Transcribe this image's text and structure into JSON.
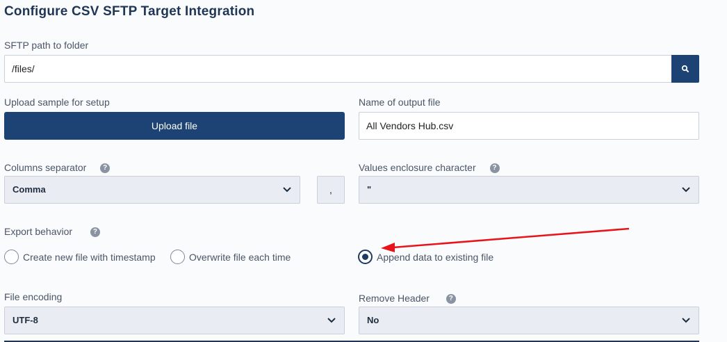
{
  "title": "Configure CSV SFTP Target Integration",
  "sftp": {
    "label": "SFTP path to folder",
    "value": "/files/",
    "search_icon": "search-icon"
  },
  "upload": {
    "label": "Upload sample for setup",
    "button": "Upload file"
  },
  "output_file": {
    "label": "Name of output file",
    "value": "All Vendors Hub.csv"
  },
  "columns_separator": {
    "label": "Columns separator",
    "help": "?",
    "selected": "Comma",
    "char": ","
  },
  "enclosure": {
    "label": "Values enclosure character",
    "help": "?",
    "selected": "\""
  },
  "export_behavior": {
    "label": "Export behavior",
    "help": "?",
    "options": [
      {
        "label": "Create new file with timestamp",
        "checked": false
      },
      {
        "label": "Overwrite file each time",
        "checked": false
      },
      {
        "label": "Append data to existing file",
        "checked": true
      }
    ]
  },
  "file_encoding": {
    "label": "File encoding",
    "selected": "UTF-8"
  },
  "remove_header": {
    "label": "Remove Header",
    "help": "?",
    "selected": "No"
  },
  "colors": {
    "primary": "#1c4373",
    "title": "#1e3556",
    "select_bg": "#e9edf3",
    "annotation_arrow": "#e8141b"
  }
}
